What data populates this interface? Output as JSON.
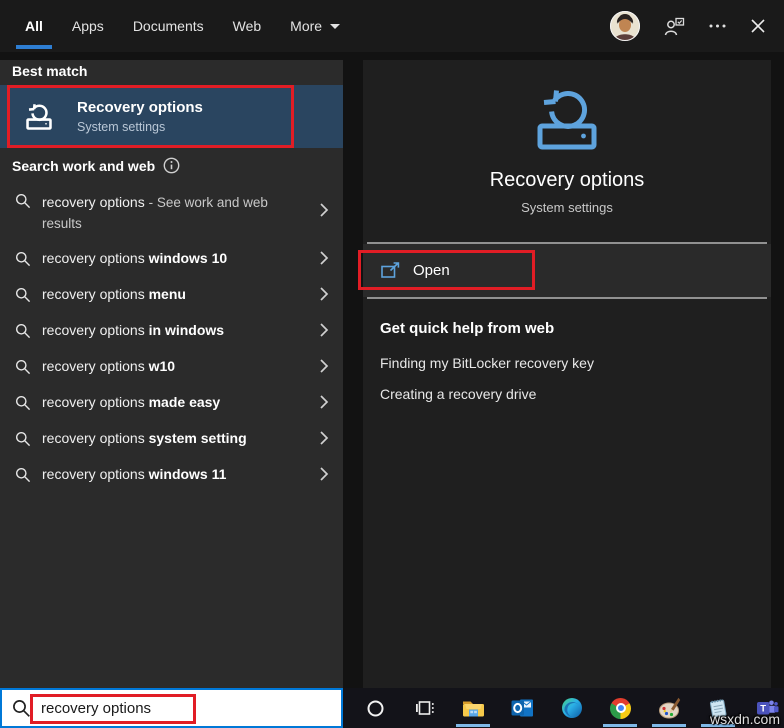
{
  "topbar": {
    "tabs": [
      {
        "label": "All",
        "active": true
      },
      {
        "label": "Apps",
        "active": false
      },
      {
        "label": "Documents",
        "active": false
      },
      {
        "label": "Web",
        "active": false
      },
      {
        "label": "More",
        "active": false,
        "caret": true
      }
    ]
  },
  "left": {
    "best_match_header": "Best match",
    "best_match": {
      "title": "Recovery options",
      "subtitle": "System settings"
    },
    "search_web_header": "Search work and web",
    "suggestions": [
      {
        "base": "recovery options",
        "bold": "",
        "note": "- See work and web results"
      },
      {
        "base": "recovery options",
        "bold": "windows 10",
        "note": ""
      },
      {
        "base": "recovery options",
        "bold": "menu",
        "note": ""
      },
      {
        "base": "recovery options",
        "bold": "in windows",
        "note": ""
      },
      {
        "base": "recovery options",
        "bold": "w10",
        "note": ""
      },
      {
        "base": "recovery options",
        "bold": "made easy",
        "note": ""
      },
      {
        "base": "recovery options",
        "bold": "system setting",
        "note": ""
      },
      {
        "base": "recovery options",
        "bold": "windows 11",
        "note": ""
      }
    ]
  },
  "right": {
    "app_title": "Recovery options",
    "app_subtitle": "System settings",
    "open_label": "Open",
    "help_header": "Get quick help from web",
    "help_links": [
      "Finding my BitLocker recovery key",
      "Creating a recovery drive"
    ]
  },
  "search_bar": {
    "value": "recovery options"
  },
  "taskbar": {
    "items": [
      {
        "id": "cortana",
        "active": false
      },
      {
        "id": "taskview",
        "active": false
      },
      {
        "id": "explorer",
        "active": true
      },
      {
        "id": "outlook",
        "active": false
      },
      {
        "id": "edge",
        "active": false
      },
      {
        "id": "chrome",
        "active": true
      },
      {
        "id": "paint",
        "active": true
      },
      {
        "id": "notepad",
        "active": true
      },
      {
        "id": "teams",
        "active": false
      }
    ]
  },
  "watermark": "wsxdn.com",
  "colors": {
    "accent_red": "#e11d25",
    "highlight_blue": "#2a4560",
    "icon_blue": "#5ea3dd",
    "search_border": "#0078d7",
    "tab_underline": "#2e7ed2"
  }
}
